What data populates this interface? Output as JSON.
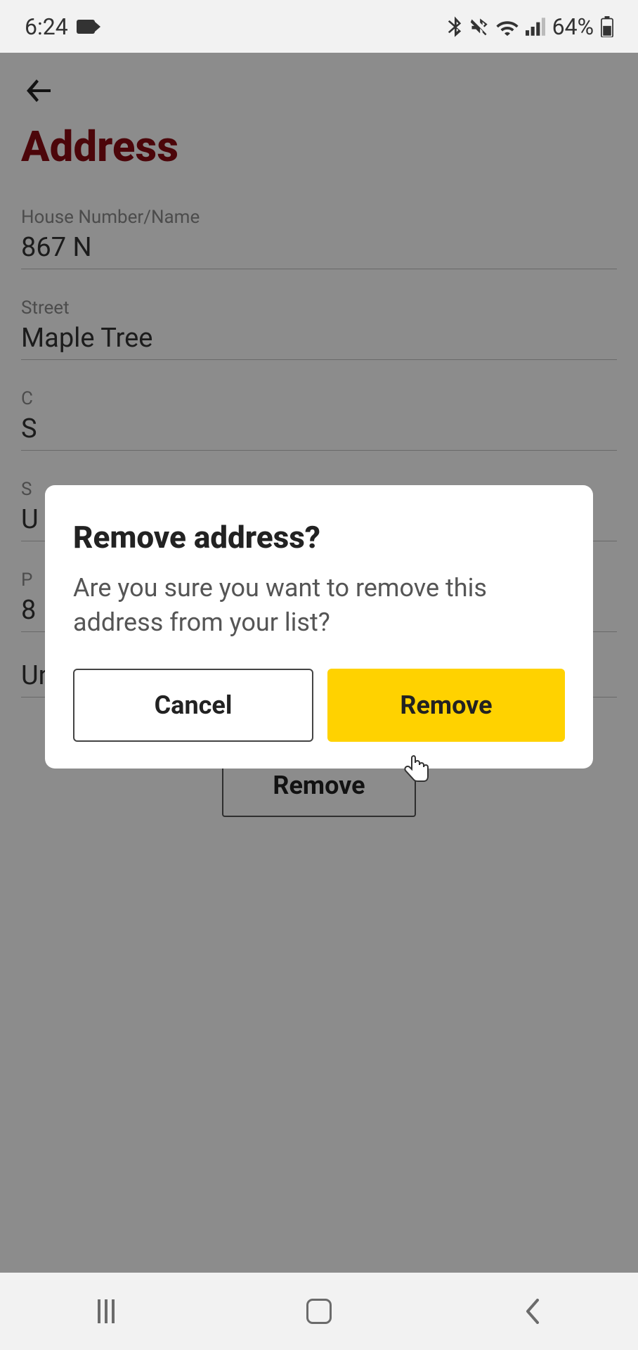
{
  "status": {
    "time": "6:24",
    "battery_pct": "64%"
  },
  "page": {
    "title": "Address",
    "remove_button": "Remove"
  },
  "fields": {
    "house": {
      "label": "House Number/Name",
      "value": "867 N"
    },
    "street": {
      "label": "Street",
      "value": "Maple Tree"
    },
    "city_label_partial": "C",
    "city_value_partial": "S",
    "state_label_partial": "S",
    "state_value_partial": "U",
    "postal_label_partial": "P",
    "postal_value_partial": "8",
    "country": {
      "value": "United Kingdom"
    }
  },
  "dialog": {
    "title": "Remove address?",
    "message": "Are you sure you want to remove this address from your list?",
    "cancel": "Cancel",
    "remove": "Remove"
  }
}
